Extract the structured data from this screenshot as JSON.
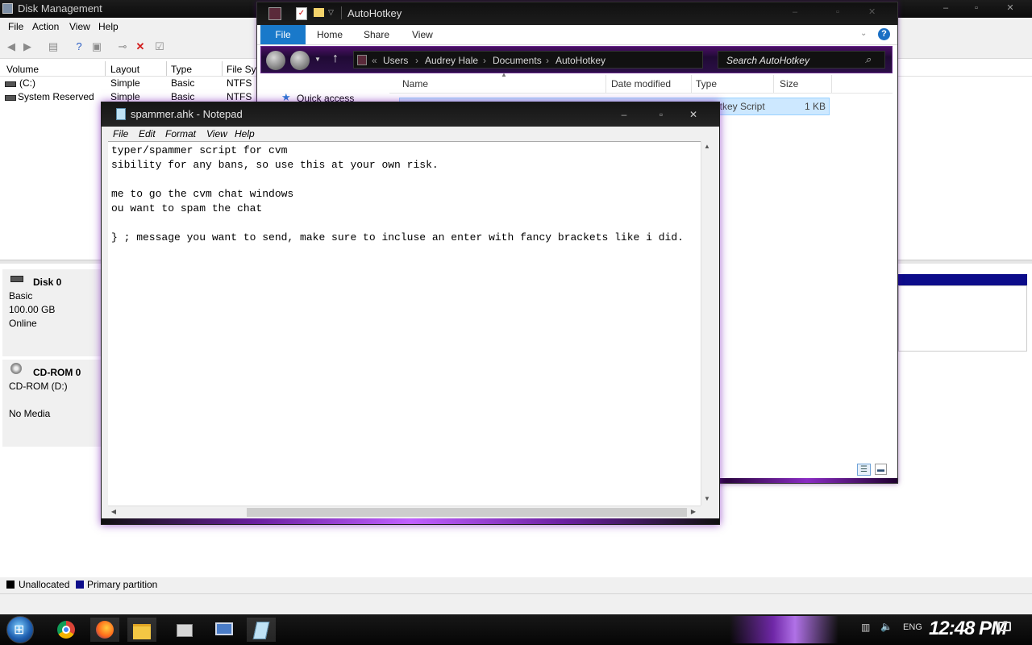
{
  "disk_management": {
    "title": "Disk Management",
    "menu": [
      "File",
      "Action",
      "View",
      "Help"
    ],
    "columns": [
      "Volume",
      "Layout",
      "Type",
      "File Sys"
    ],
    "volumes": [
      {
        "name": "(C:)",
        "layout": "Simple",
        "type": "Basic",
        "fs": "NTFS"
      },
      {
        "name": "System Reserved",
        "layout": "Simple",
        "type": "Basic",
        "fs": "NTFS"
      }
    ],
    "disks": [
      {
        "name": "Disk 0",
        "kind": "Basic",
        "size": "100.00 GB",
        "status": "Online"
      },
      {
        "name": "CD-ROM 0",
        "kind": "CD-ROM (D:)",
        "size": "",
        "status": "No Media"
      }
    ],
    "legend": [
      {
        "label": "Unallocated",
        "color": "#000000"
      },
      {
        "label": "Primary partition",
        "color": "#0c0c8a"
      }
    ]
  },
  "explorer": {
    "title": "AutoHotkey",
    "ribbon_tabs": [
      "File",
      "Home",
      "Share",
      "View"
    ],
    "breadcrumb": [
      "Users",
      "Audrey Hale",
      "Documents",
      "AutoHotkey"
    ],
    "search_placeholder": "Search AutoHotkey",
    "nav_items": [
      "Quick access"
    ],
    "columns": [
      "Name",
      "Date modified",
      "Type",
      "Size"
    ],
    "file": {
      "type": "AutoHotkey Script",
      "type_visible": "otkey Script",
      "size": "1 KB"
    }
  },
  "notepad": {
    "title": "spammer.ahk - Notepad",
    "menu": [
      "File",
      "Edit",
      "Format",
      "View",
      "Help"
    ],
    "content": "typer/spammer script for cvm\nsibility for any bans, so use this at your own risk.\n\nme to go the cvm chat windows\nou want to spam the chat\n\n} ; message you want to send, make sure to incluse an enter with fancy brackets like i did."
  },
  "taskbar": {
    "apps": [
      "chrome-icon",
      "firefox-icon",
      "file-explorer-icon",
      "installer-icon",
      "computer-management-icon",
      "notepad-icon"
    ],
    "language": "ENG",
    "clock": "12:48 PM"
  },
  "colors": {
    "accent_blue": "#1979ca",
    "purple_glow": "#8a2bc4",
    "primary_partition": "#0c0c8a"
  }
}
